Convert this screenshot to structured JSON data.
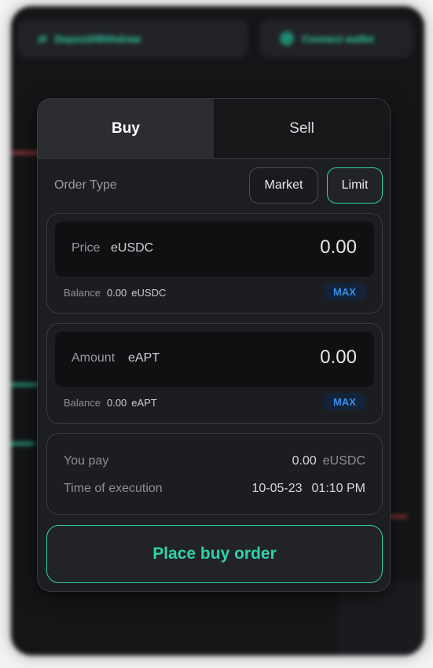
{
  "background": {
    "deposit_label": "Deposit/Withdraw",
    "connect_label": "Connect wallet"
  },
  "tabs": [
    {
      "label": "Buy",
      "active": true
    },
    {
      "label": "Sell",
      "active": false
    }
  ],
  "order_type": {
    "label": "Order Type",
    "options": [
      "Market",
      "Limit"
    ],
    "selected": "Limit"
  },
  "price": {
    "label": "Price",
    "unit": "eUSDC",
    "value": "0.00",
    "balance_label": "Balance",
    "balance_value": "0.00",
    "balance_unit": "eUSDC",
    "max_label": "MAX"
  },
  "amount": {
    "label": "Amount",
    "unit": "eAPT",
    "value": "0.00",
    "balance_label": "Balance",
    "balance_value": "0.00",
    "balance_unit": "eAPT",
    "max_label": "MAX"
  },
  "summary": {
    "you_pay_label": "You pay",
    "you_pay_value": "0.00",
    "you_pay_unit": "eUSDC",
    "time_label": "Time of execution",
    "date": "10-05-23",
    "time": "01:10 PM"
  },
  "submit_label": "Place buy order",
  "colors": {
    "accent": "#2fd1a8",
    "max_text": "#3a8ee6",
    "panel": "#1d1e21"
  }
}
